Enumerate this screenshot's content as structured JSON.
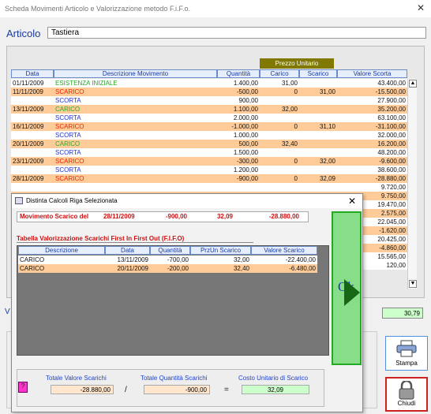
{
  "window": {
    "title": "Scheda Movimenti Articolo e Valorizzazione metodo F.i.F.o.",
    "close_glyph": "✕"
  },
  "articolo": {
    "label": "Articolo",
    "value": "Tastiera"
  },
  "grid": {
    "group_header": "Prezzo Unitario",
    "columns": [
      "Data",
      "Descrizione Movimento",
      "Quantità",
      "Carico",
      "Scarico",
      "Valore Scorta"
    ],
    "rows": [
      {
        "data": "01/11/2009",
        "desc": "ESISTENZA INIZIALE",
        "qta": "1.400,00",
        "car": "31,00",
        "sca": "",
        "val": "43.400,00",
        "bg": "white",
        "color": "green"
      },
      {
        "data": "11/11/2009",
        "desc": "SCARICO",
        "qta": "-500,00",
        "car": "0",
        "sca": "31,00",
        "val": "-15.500,00",
        "bg": "orange",
        "color": "red"
      },
      {
        "data": "",
        "desc": "SCORTA",
        "qta": "900,00",
        "car": "",
        "sca": "",
        "val": "27.900,00",
        "bg": "white",
        "color": "blue"
      },
      {
        "data": "13/11/2009",
        "desc": "CARICO",
        "qta": "1.100,00",
        "car": "32,00",
        "sca": "",
        "val": "35.200,00",
        "bg": "orange",
        "color": "green"
      },
      {
        "data": "",
        "desc": "SCORTA",
        "qta": "2.000,00",
        "car": "",
        "sca": "",
        "val": "63.100,00",
        "bg": "white",
        "color": "blue"
      },
      {
        "data": "16/11/2009",
        "desc": "SCARICO",
        "qta": "-1.000,00",
        "car": "0",
        "sca": "31,10",
        "val": "-31.100,00",
        "bg": "orange",
        "color": "red"
      },
      {
        "data": "",
        "desc": "SCORTA",
        "qta": "1.000,00",
        "car": "",
        "sca": "",
        "val": "32.000,00",
        "bg": "white",
        "color": "blue"
      },
      {
        "data": "20/11/2009",
        "desc": "CARICO",
        "qta": "500,00",
        "car": "32,40",
        "sca": "",
        "val": "16.200,00",
        "bg": "orange",
        "color": "green"
      },
      {
        "data": "",
        "desc": "SCORTA",
        "qta": "1.500,00",
        "car": "",
        "sca": "",
        "val": "48.200,00",
        "bg": "white",
        "color": "blue"
      },
      {
        "data": "23/11/2009",
        "desc": "SCARICO",
        "qta": "-300,00",
        "car": "0",
        "sca": "32,00",
        "val": "-9.600,00",
        "bg": "orange",
        "color": "red"
      },
      {
        "data": "",
        "desc": "SCORTA",
        "qta": "1.200,00",
        "car": "",
        "sca": "",
        "val": "38.600,00",
        "bg": "white",
        "color": "blue"
      },
      {
        "data": "28/11/2009",
        "desc": "SCARICO",
        "qta": "-900,00",
        "car": "0",
        "sca": "32,09",
        "val": "-28.880,00",
        "bg": "orange",
        "color": "red"
      },
      {
        "data": "",
        "desc": "",
        "qta": "",
        "car": "",
        "sca": "",
        "val": "9.720,00",
        "bg": "white",
        "color": "blue"
      },
      {
        "data": "",
        "desc": "",
        "qta": "",
        "car": "",
        "sca": "",
        "val": "9.750,00",
        "bg": "orange",
        "color": "green"
      },
      {
        "data": "",
        "desc": "",
        "qta": "",
        "car": "",
        "sca": "",
        "val": "19.470,00",
        "bg": "white",
        "color": "blue"
      },
      {
        "data": "",
        "desc": "",
        "qta": "",
        "car": "",
        "sca": "",
        "val": "2.575,00",
        "bg": "orange",
        "color": "green"
      },
      {
        "data": "",
        "desc": "",
        "qta": "",
        "car": "",
        "sca": "",
        "val": "22.045,00",
        "bg": "white",
        "color": "blue"
      },
      {
        "data": "",
        "desc": "",
        "qta": "",
        "car": "",
        "sca": "",
        "val": "-1.620,00",
        "bg": "orange",
        "color": "red"
      },
      {
        "data": "",
        "desc": "",
        "qta": "",
        "car": "",
        "sca": "",
        "val": "20.425,00",
        "bg": "white",
        "color": "blue"
      },
      {
        "data": "",
        "desc": "",
        "qta": "",
        "car": "",
        "sca": "",
        "val": "-4.860,00",
        "bg": "orange",
        "color": "red"
      },
      {
        "data": "",
        "desc": "",
        "qta": "",
        "car": "",
        "sca": "",
        "val": "15.565,00",
        "bg": "white",
        "color": "blue"
      },
      {
        "data": "",
        "desc": "",
        "qta": "",
        "car": "",
        "sca": "",
        "val": "120,00",
        "bg": "white",
        "color": "dark"
      }
    ]
  },
  "avg_cost": "30,79",
  "v_label": "V",
  "buttons": {
    "stampa": "Stampa",
    "chiudi": "Chiudi"
  },
  "dialog": {
    "title": "Distinta Calcoli Riga Selezionata",
    "close_glyph": "✕",
    "movimento": {
      "label": "Movimento Scarico del",
      "date": "28/11/2009",
      "qta": "-900,00",
      "price": "32,09",
      "value": "-28.880,00"
    },
    "table_title": "Tabella Valorizzazione Scarichi First In First Out (F.I.F.O)",
    "columns": [
      "Descrizione",
      "Data",
      "Quantità",
      "PrzUn Scarico",
      "Valore Scarico"
    ],
    "rows": [
      {
        "desc": "CARICO",
        "data": "13/11/2009",
        "qta": "-700,00",
        "prz": "32,00",
        "val": "-22.400,00"
      },
      {
        "desc": "CARICO",
        "data": "20/11/2009",
        "qta": "-200,00",
        "prz": "32,40",
        "val": "-6.480,00"
      }
    ],
    "ok_label": "Ok",
    "totals": {
      "valore_label": "Totale Valore Scarichi",
      "valore": "-28.880,00",
      "div": "/",
      "quantita_label": "Totale Quantità Scarichi",
      "quantita": "-900,00",
      "eq": "=",
      "costo_label": "Costo Unitario di Scarico",
      "costo": "32,09",
      "pink_icon_char": "?"
    }
  }
}
